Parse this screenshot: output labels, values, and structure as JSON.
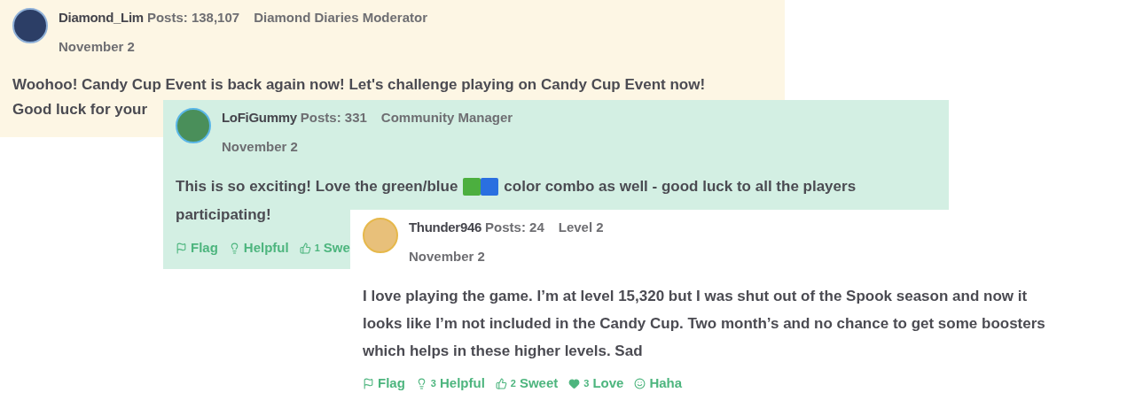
{
  "posts": [
    {
      "author": "Diamond_Lim",
      "posts": "Posts: 138,107",
      "role": "Diamond Diaries Moderator",
      "date": "November 2",
      "color": "#fdf6e4",
      "body": [
        [
          {
            "kind": "text",
            "text": "Woohoo! Candy Cup Event is back again now! Let's challenge playing on Candy Cup Event now!"
          }
        ],
        [
          {
            "kind": "text",
            "text": "Good luck for your"
          }
        ]
      ]
    },
    {
      "author": "LoFiGummy",
      "posts": "Posts: 331",
      "role": "Community Manager",
      "date": "November 2",
      "color": "#d3efe3",
      "body": [
        [
          {
            "kind": "text",
            "text": "This is so exciting! Love the green/blue"
          },
          {
            "kind": "swatch",
            "color": "#4caf3f"
          },
          {
            "kind": "swatch",
            "color": "#2a6fe0"
          },
          {
            "kind": "text",
            "text": "color combo as well - good luck to all the players"
          }
        ],
        [
          {
            "kind": "text",
            "text": "participating!"
          }
        ]
      ],
      "actions": [
        {
          "kind": "flag",
          "label": "Flag"
        },
        {
          "kind": "helpful",
          "label": "Helpful"
        },
        {
          "kind": "sweet",
          "count": "1",
          "label": "Swe"
        }
      ]
    },
    {
      "author": "Thunder946",
      "posts": "Posts: 24",
      "role": "Level 2",
      "date": "November 2",
      "color": "#ffffff",
      "body": [
        [
          {
            "kind": "text",
            "text": "I love playing the game. I’m at level 15,320 but I was shut out of the Spook season and now it"
          }
        ],
        [
          {
            "kind": "text",
            "text": "looks like I’m not included in the Candy Cup. Two month’s and no chance to get some boosters"
          }
        ],
        [
          {
            "kind": "text",
            "text": "which helps in these higher levels. Sad"
          }
        ]
      ],
      "actions": [
        {
          "kind": "flag",
          "label": "Flag"
        },
        {
          "kind": "helpful",
          "count": "3",
          "label": "Helpful"
        },
        {
          "kind": "sweet",
          "count": "2",
          "label": "Sweet"
        },
        {
          "kind": "love",
          "count": "3",
          "label": "Love"
        },
        {
          "kind": "haha",
          "label": "Haha"
        }
      ]
    }
  ]
}
